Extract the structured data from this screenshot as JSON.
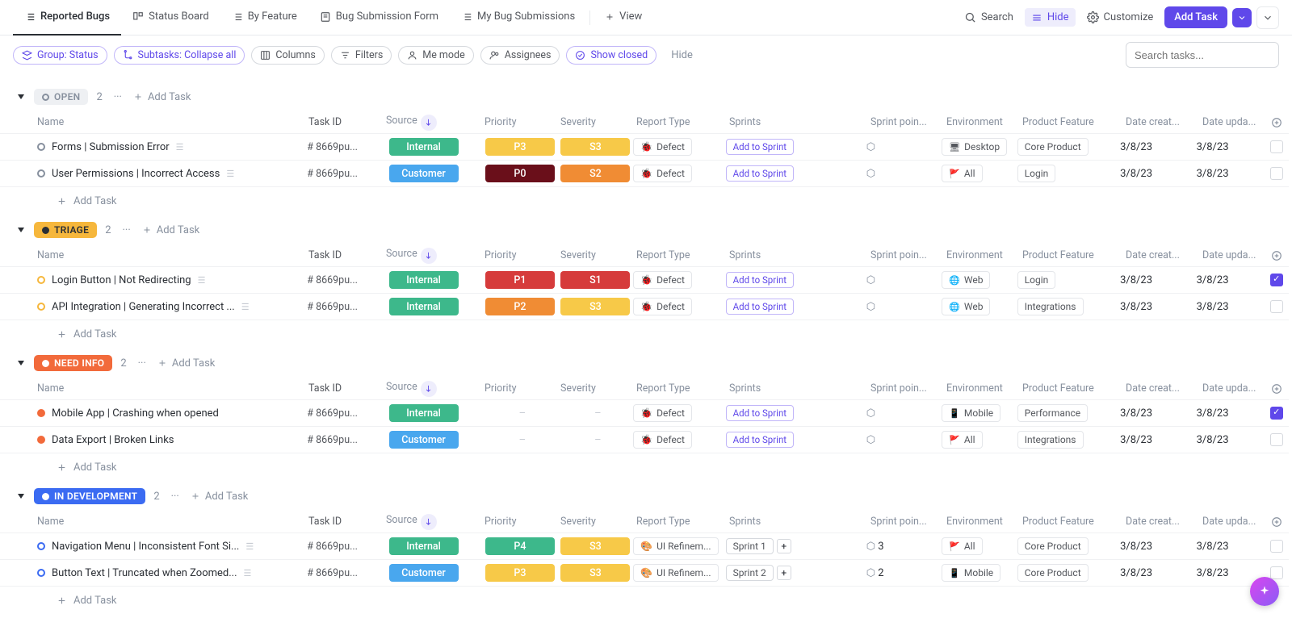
{
  "top": {
    "tabs": [
      {
        "label": "Reported Bugs"
      },
      {
        "label": "Status Board"
      },
      {
        "label": "By Feature"
      },
      {
        "label": "Bug Submission Form"
      },
      {
        "label": "My Bug Submissions"
      }
    ],
    "add_view": "View",
    "search": "Search",
    "hide": "Hide",
    "customize": "Customize",
    "add_task": "Add Task"
  },
  "filters": {
    "group": "Group: Status",
    "subtasks": "Subtasks: Collapse all",
    "columns": "Columns",
    "filters": "Filters",
    "me": "Me mode",
    "assignees": "Assignees",
    "show_closed": "Show closed",
    "hide": "Hide",
    "search_placeholder": "Search tasks..."
  },
  "columns": {
    "name": "Name",
    "taskid": "Task ID",
    "source": "Source",
    "priority": "Priority",
    "severity": "Severity",
    "type": "Report Type",
    "sprint": "Sprints",
    "points": "Sprint poin...",
    "env": "Environment",
    "feature": "Product Feature",
    "created": "Date creat...",
    "updated": "Date upda..."
  },
  "add_task_row": "Add Task",
  "groups": [
    {
      "key": "open",
      "label": "OPEN",
      "count": "2",
      "pill_bg": "#eef0f3",
      "pill_fg": "#87909e",
      "dot": "#87909e",
      "dot_filled": false,
      "rows": [
        {
          "dot": "#87909e",
          "dot_filled": false,
          "name": "Forms | Submission Error",
          "desc": true,
          "taskid": "# 8669pu...",
          "source": "Internal",
          "source_bg": "#3db88b",
          "priority": "P3",
          "priority_bg": "#f7c948",
          "severity": "S3",
          "severity_bg": "#f7c948",
          "type": "Defect",
          "type_icon": "🐞",
          "sprint": "Add to Sprint",
          "points": "",
          "env": "Desktop",
          "env_icon": "🖥",
          "feature": "Core Product",
          "created": "3/8/23",
          "updated": "3/8/23",
          "checked": false
        },
        {
          "dot": "#87909e",
          "dot_filled": false,
          "name": "User Permissions | Incorrect Access",
          "desc": true,
          "taskid": "# 8669pu...",
          "source": "Customer",
          "source_bg": "#49a7ee",
          "priority": "P0",
          "priority_bg": "#6a0f1a",
          "severity": "S2",
          "severity_bg": "#f08c34",
          "type": "Defect",
          "type_icon": "🐞",
          "sprint": "Add to Sprint",
          "points": "",
          "env": "All",
          "env_icon": "🚩",
          "feature": "Login",
          "created": "3/8/23",
          "updated": "3/8/23",
          "checked": false
        }
      ]
    },
    {
      "key": "triage",
      "label": "TRIAGE",
      "count": "2",
      "pill_bg": "#f6b73c",
      "pill_fg": "#2a2e34",
      "dot": "#2a2e34",
      "dot_filled": true,
      "rows": [
        {
          "dot": "#f6b73c",
          "dot_filled": false,
          "name": "Login Button | Not Redirecting",
          "desc": true,
          "taskid": "# 8669pu...",
          "source": "Internal",
          "source_bg": "#3db88b",
          "priority": "P1",
          "priority_bg": "#d63b3b",
          "severity": "S1",
          "severity_bg": "#d63b3b",
          "type": "Defect",
          "type_icon": "🐞",
          "sprint": "Add to Sprint",
          "points": "",
          "env": "Web",
          "env_icon": "🌐",
          "feature": "Login",
          "created": "3/8/23",
          "updated": "3/8/23",
          "checked": true
        },
        {
          "dot": "#f6b73c",
          "dot_filled": false,
          "name": "API Integration | Generating Incorrect ...",
          "desc": true,
          "taskid": "# 8669pu...",
          "source": "Internal",
          "source_bg": "#3db88b",
          "priority": "P2",
          "priority_bg": "#f08c34",
          "severity": "S3",
          "severity_bg": "#f7c948",
          "type": "Defect",
          "type_icon": "🐞",
          "sprint": "Add to Sprint",
          "points": "",
          "env": "Web",
          "env_icon": "🌐",
          "feature": "Integrations",
          "created": "3/8/23",
          "updated": "3/8/23",
          "checked": false
        }
      ]
    },
    {
      "key": "needinfo",
      "label": "NEED INFO",
      "count": "2",
      "pill_bg": "#f26a3b",
      "pill_fg": "#fff",
      "dot": "#fff",
      "dot_filled": true,
      "rows": [
        {
          "dot": "#f26a3b",
          "dot_filled": true,
          "name": "Mobile App | Crashing when opened",
          "desc": false,
          "taskid": "# 8669pu...",
          "source": "Internal",
          "source_bg": "#3db88b",
          "priority": "–",
          "priority_bg": "",
          "severity": "–",
          "severity_bg": "",
          "type": "Defect",
          "type_icon": "🐞",
          "sprint": "Add to Sprint",
          "points": "",
          "env": "Mobile",
          "env_icon": "📱",
          "feature": "Performance",
          "created": "3/8/23",
          "updated": "3/8/23",
          "checked": true
        },
        {
          "dot": "#f26a3b",
          "dot_filled": true,
          "name": "Data Export | Broken Links",
          "desc": false,
          "taskid": "# 8669pu...",
          "source": "Customer",
          "source_bg": "#49a7ee",
          "priority": "–",
          "priority_bg": "",
          "severity": "–",
          "severity_bg": "",
          "type": "Defect",
          "type_icon": "🐞",
          "sprint": "Add to Sprint",
          "points": "",
          "env": "All",
          "env_icon": "🚩",
          "feature": "Integrations",
          "created": "3/8/23",
          "updated": "3/8/23",
          "checked": false
        }
      ]
    },
    {
      "key": "indev",
      "label": "IN DEVELOPMENT",
      "count": "2",
      "pill_bg": "#3b6bf2",
      "pill_fg": "#fff",
      "dot": "#fff",
      "dot_filled": true,
      "rows": [
        {
          "dot": "#3b6bf2",
          "dot_filled": false,
          "name": "Navigation Menu | Inconsistent Font Si...",
          "desc": true,
          "taskid": "# 8669pu...",
          "source": "Internal",
          "source_bg": "#3db88b",
          "priority": "P4",
          "priority_bg": "#3db88b",
          "severity": "S3",
          "severity_bg": "#f7c948",
          "type": "UI Refinem...",
          "type_icon": "🎨",
          "sprint_pill": "Sprint 1",
          "points": "3",
          "env": "All",
          "env_icon": "🚩",
          "feature": "Core Product",
          "created": "3/8/23",
          "updated": "3/8/23",
          "checked": false
        },
        {
          "dot": "#3b6bf2",
          "dot_filled": false,
          "name": "Button Text | Truncated when Zoomed...",
          "desc": true,
          "taskid": "# 8669pu...",
          "source": "Customer",
          "source_bg": "#49a7ee",
          "priority": "P3",
          "priority_bg": "#f7c948",
          "severity": "S3",
          "severity_bg": "#f7c948",
          "type": "UI Refinem...",
          "type_icon": "🎨",
          "sprint_pill": "Sprint 2",
          "points": "2",
          "env": "Mobile",
          "env_icon": "📱",
          "feature": "Core Product",
          "created": "3/8/23",
          "updated": "3/8/23",
          "checked": false
        }
      ]
    }
  ]
}
